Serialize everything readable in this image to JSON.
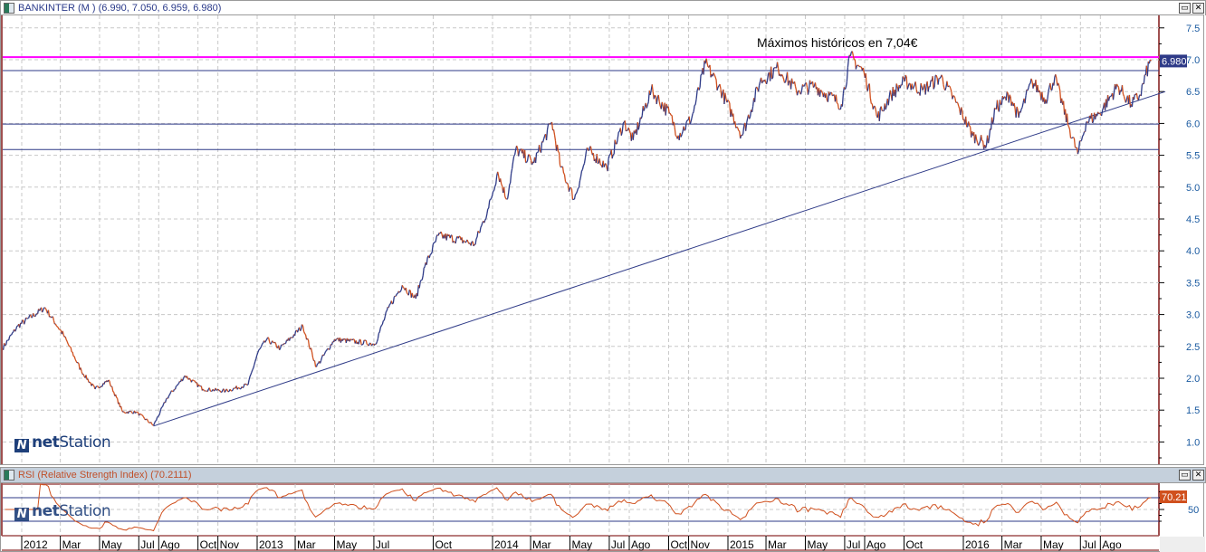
{
  "header": {
    "title": "BANKINTER (M ) (6.990, 7.050, 6.959, 6.980)"
  },
  "rsi_panel": {
    "title": "RSI (Relative Strength Index) (70.2111)"
  },
  "logo": {
    "prefix": "net",
    "suffix": "Station"
  },
  "window_buttons": {
    "maximize": "▭",
    "close": "✕"
  },
  "colors": {
    "up": "#2e3a87",
    "down": "#d0501e",
    "max_line": "#ff00ff",
    "support_lines": "#2e3a87",
    "last_price_badge": "#2e3a87",
    "rsi_line": "#d0501e",
    "rsi_badge": "#d0501e",
    "frame": "#a05050"
  },
  "chart_data": [
    {
      "type": "line",
      "title": "BANKINTER (M ) (6.990, 7.050, 6.959, 6.980)",
      "annotation": "Máximos históricos en 7,04€",
      "last_value_label": "6.980",
      "ylim": [
        0.8,
        7.7
      ],
      "y_ticks": [
        "7.5",
        "7.0",
        "6.5",
        "6.0",
        "5.5",
        "5.0",
        "4.5",
        "4.0",
        "3.5",
        "3.0",
        "2.5",
        "2.0",
        "1.5",
        "1.0"
      ],
      "grid": true,
      "x_ticks": [
        {
          "label": "2012",
          "date": "2012-01-01"
        },
        {
          "label": "Mar",
          "date": "2012-03-01"
        },
        {
          "label": "May",
          "date": "2012-05-01"
        },
        {
          "label": "Jul",
          "date": "2012-07-01"
        },
        {
          "label": "Ago",
          "date": "2012-08-01"
        },
        {
          "label": "Oct",
          "date": "2012-10-01"
        },
        {
          "label": "Nov",
          "date": "2012-11-01"
        },
        {
          "label": "2013",
          "date": "2013-01-01"
        },
        {
          "label": "Mar",
          "date": "2013-03-01"
        },
        {
          "label": "May",
          "date": "2013-05-01"
        },
        {
          "label": "Jul",
          "date": "2013-07-01"
        },
        {
          "label": "Oct",
          "date": "2013-10-01"
        },
        {
          "label": "2014",
          "date": "2014-01-01"
        },
        {
          "label": "Mar",
          "date": "2014-03-01"
        },
        {
          "label": "May",
          "date": "2014-05-01"
        },
        {
          "label": "Jul",
          "date": "2014-07-01"
        },
        {
          "label": "Ago",
          "date": "2014-08-01"
        },
        {
          "label": "Oct",
          "date": "2014-10-01"
        },
        {
          "label": "Nov",
          "date": "2014-11-01"
        },
        {
          "label": "2015",
          "date": "2015-01-01"
        },
        {
          "label": "Mar",
          "date": "2015-03-01"
        },
        {
          "label": "May",
          "date": "2015-05-01"
        },
        {
          "label": "Jul",
          "date": "2015-07-01"
        },
        {
          "label": "Ago",
          "date": "2015-08-01"
        },
        {
          "label": "Oct",
          "date": "2015-10-01"
        },
        {
          "label": "2016",
          "date": "2016-01-01"
        },
        {
          "label": "Mar",
          "date": "2016-03-01"
        },
        {
          "label": "May",
          "date": "2016-05-01"
        },
        {
          "label": "Jul",
          "date": "2016-07-01"
        },
        {
          "label": "Ago",
          "date": "2016-08-01"
        }
      ],
      "horizontal_lines": [
        {
          "value": 7.04,
          "color": "#ff00ff"
        },
        {
          "value": 6.83,
          "color": "#2e3a87"
        },
        {
          "value": 5.99,
          "color": "#2e3a87"
        },
        {
          "value": 5.59,
          "color": "#2e3a87"
        }
      ],
      "trendline": [
        {
          "date": "2012-07-24",
          "value": 1.25
        },
        {
          "date": "2016-11-10",
          "value": 6.5
        }
      ],
      "series": [
        {
          "points": [
            [
              "2011-12-02",
              2.47
            ],
            [
              "2011-12-26",
              2.82
            ],
            [
              "2012-02-06",
              3.11
            ],
            [
              "2012-03-06",
              2.68
            ],
            [
              "2012-04-03",
              2.11
            ],
            [
              "2012-04-24",
              1.83
            ],
            [
              "2012-05-15",
              1.97
            ],
            [
              "2012-06-06",
              1.47
            ],
            [
              "2012-06-27",
              1.47
            ],
            [
              "2012-07-24",
              1.26
            ],
            [
              "2012-08-14",
              1.69
            ],
            [
              "2012-09-11",
              2.04
            ],
            [
              "2012-10-09",
              1.83
            ],
            [
              "2012-11-13",
              1.8
            ],
            [
              "2012-12-18",
              1.9
            ],
            [
              "2013-01-02",
              2.4
            ],
            [
              "2013-01-16",
              2.61
            ],
            [
              "2013-02-06",
              2.47
            ],
            [
              "2013-03-13",
              2.82
            ],
            [
              "2013-04-03",
              2.18
            ],
            [
              "2013-05-01",
              2.61
            ],
            [
              "2013-06-06",
              2.57
            ],
            [
              "2013-07-03",
              2.54
            ],
            [
              "2013-07-24",
              3.11
            ],
            [
              "2013-08-14",
              3.46
            ],
            [
              "2013-09-04",
              3.25
            ],
            [
              "2013-09-18",
              3.75
            ],
            [
              "2013-10-09",
              4.24
            ],
            [
              "2013-11-13",
              4.17
            ],
            [
              "2013-12-04",
              4.1
            ],
            [
              "2013-12-26",
              4.67
            ],
            [
              "2014-01-09",
              5.24
            ],
            [
              "2014-01-23",
              4.81
            ],
            [
              "2014-02-06",
              5.59
            ],
            [
              "2014-03-06",
              5.38
            ],
            [
              "2014-04-03",
              6.02
            ],
            [
              "2014-04-17",
              5.31
            ],
            [
              "2014-05-08",
              4.81
            ],
            [
              "2014-05-29",
              5.59
            ],
            [
              "2014-06-27",
              5.31
            ],
            [
              "2014-07-24",
              6.02
            ],
            [
              "2014-08-07",
              5.74
            ],
            [
              "2014-09-04",
              6.52
            ],
            [
              "2014-10-02",
              6.16
            ],
            [
              "2014-10-16",
              5.81
            ],
            [
              "2014-11-06",
              6.09
            ],
            [
              "2014-11-27",
              6.94
            ],
            [
              "2014-12-18",
              6.59
            ],
            [
              "2015-01-23",
              5.81
            ],
            [
              "2015-02-20",
              6.66
            ],
            [
              "2015-03-20",
              6.87
            ],
            [
              "2015-04-17",
              6.52
            ],
            [
              "2015-05-15",
              6.59
            ],
            [
              "2015-06-26",
              6.3
            ],
            [
              "2015-07-10",
              7.06
            ],
            [
              "2015-07-31",
              6.8
            ],
            [
              "2015-08-21",
              6.09
            ],
            [
              "2015-09-11",
              6.45
            ],
            [
              "2015-10-02",
              6.66
            ],
            [
              "2015-10-30",
              6.52
            ],
            [
              "2015-11-27",
              6.73
            ],
            [
              "2015-12-26",
              6.23
            ],
            [
              "2016-01-16",
              5.81
            ],
            [
              "2016-02-06",
              5.66
            ],
            [
              "2016-02-20",
              6.23
            ],
            [
              "2016-03-13",
              6.45
            ],
            [
              "2016-03-27",
              6.09
            ],
            [
              "2016-04-17",
              6.66
            ],
            [
              "2016-05-08",
              6.38
            ],
            [
              "2016-05-22",
              6.73
            ],
            [
              "2016-06-13",
              5.95
            ],
            [
              "2016-06-27",
              5.52
            ],
            [
              "2016-07-10",
              6.02
            ],
            [
              "2016-07-31",
              6.16
            ],
            [
              "2016-08-28",
              6.59
            ],
            [
              "2016-09-18",
              6.3
            ],
            [
              "2016-10-02",
              6.45
            ],
            [
              "2016-10-16",
              6.94
            ],
            [
              "2016-10-19",
              6.98
            ]
          ]
        }
      ]
    },
    {
      "type": "line",
      "title": "RSI (Relative Strength Index) (70.2111)",
      "ylim": [
        0,
        100
      ],
      "y_ticks": [
        "50"
      ],
      "reference_lines": [
        70,
        30
      ],
      "last_value_label": "70.21",
      "last_value": 70.2111
    }
  ]
}
